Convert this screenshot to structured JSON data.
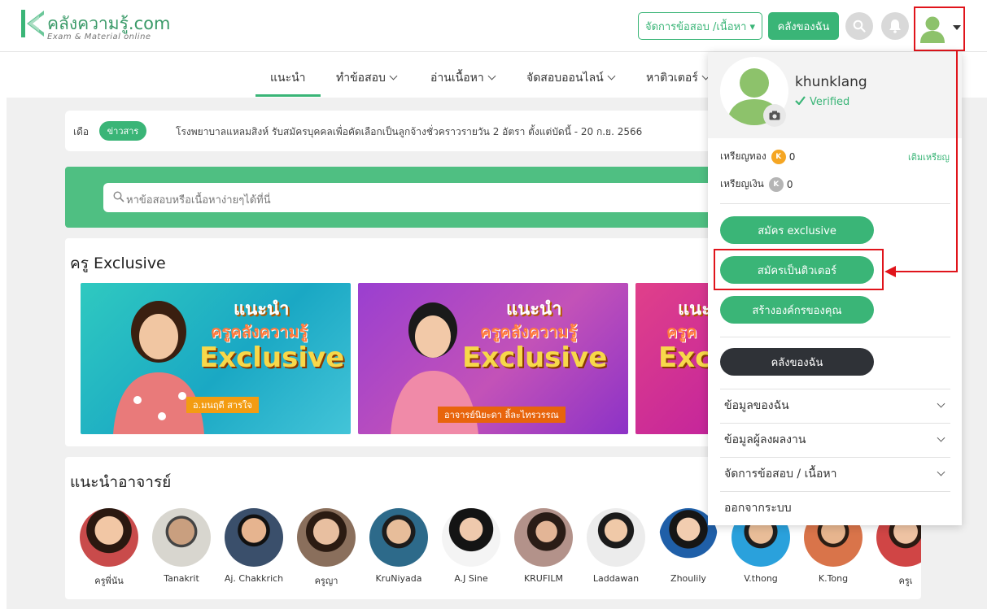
{
  "header": {
    "logo_title": "คลังความรู้.com",
    "logo_subtitle": "Exam & Material online",
    "manage_button": "จัดการข้อสอบ /เนื้อหา ▾",
    "my_store_button": "คลังของฉัน"
  },
  "nav": {
    "items": [
      {
        "label": "แนะนำ"
      },
      {
        "label": "ทำข้อสอบ"
      },
      {
        "label": "อ่านเนื้อหา"
      },
      {
        "label": "จัดสอบออนไลน์"
      },
      {
        "label": "หาติวเตอร์"
      }
    ]
  },
  "news": {
    "prefix": "เดือ",
    "badge": "ข่าวสาร",
    "text": "โรงพยาบาลแหลมสิงห์ รับสมัครบุคคลเพื่อคัดเลือกเป็นลูกจ้างชั่วคราวรายวัน 2 อัตรา ตั้งแต่บัดนี้ - 20 ก.ย. 2566"
  },
  "search": {
    "placeholder": "หาข้อสอบหรือเนื้อหาง่ายๆได้ที่นี่"
  },
  "exclusive": {
    "title": "ครู Exclusive",
    "banners": [
      {
        "line1": "แนะนำ",
        "line2": "ครูคลังความรู้",
        "line3": "Exclusive",
        "name": "อ.มนฤดี สารใจ"
      },
      {
        "line1": "แนะนำ",
        "line2": "ครูคลังความรู้",
        "line3": "Exclusive",
        "name": "อาจารย์นิยะดา ลิ้ละไทรวรรณ"
      },
      {
        "line1": "แนะ",
        "line2": "ครูค",
        "line3": "Excl",
        "name": ""
      }
    ]
  },
  "teachers": {
    "title": "แนะนำอาจารย์",
    "items": [
      {
        "name": "ครูพี่นัน"
      },
      {
        "name": "Tanakrit"
      },
      {
        "name": "Aj. Chakkrich"
      },
      {
        "name": "ครูญา"
      },
      {
        "name": "KruNiyada"
      },
      {
        "name": "A.J Sine"
      },
      {
        "name": "KRUFILM"
      },
      {
        "name": "Laddawan"
      },
      {
        "name": "Zhoulily"
      },
      {
        "name": "V.thong"
      },
      {
        "name": "K.Tong"
      },
      {
        "name": "ครูเ"
      }
    ]
  },
  "dropdown": {
    "username": "khunklang",
    "verified": "Verified",
    "gold_label": "เหรียญทอง",
    "gold_value": "0",
    "silver_label": "เหรียญเงิน",
    "silver_value": "0",
    "topup": "เติมเหรียญ",
    "btn_exclusive": "สมัคร exclusive",
    "btn_tutor": "สมัครเป็นติวเตอร์",
    "btn_org": "สร้างองค์กรของคุณ",
    "btn_my_store": "คลังของฉัน",
    "rows": [
      {
        "label": "ข้อมูลของฉัน"
      },
      {
        "label": "ข้อมูลผู้ลงผลงาน"
      },
      {
        "label": "จัดการข้อสอบ / เนื้อหา"
      }
    ],
    "logout": "ออกจากระบบ"
  },
  "colors": {
    "brand_green": "#3ab577",
    "highlight_red": "#e0141b",
    "gold": "#f5a623",
    "silver": "#b5b5b5"
  }
}
